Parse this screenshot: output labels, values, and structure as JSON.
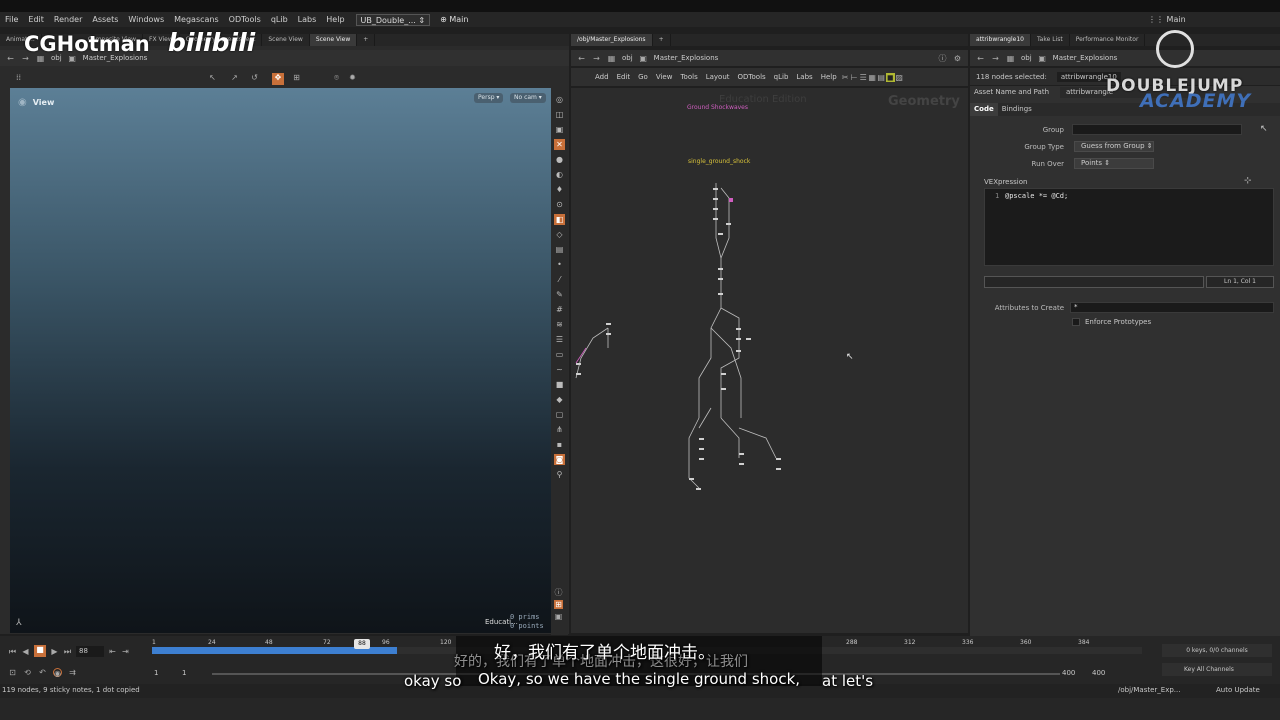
{
  "menubar": {
    "items": [
      "File",
      "Edit",
      "Render",
      "Assets",
      "Windows",
      "Megascans",
      "ODTools",
      "qLib",
      "Labs",
      "Help"
    ],
    "desktop_left": "UB_Double_...",
    "desktop_mid": "Main",
    "desktop_right": "Main"
  },
  "left_pane": {
    "tabs": [
      "Animati...",
      "Composite View",
      "FX View",
      "Geometry Spreadsheet",
      "Scene View",
      "Scene View"
    ],
    "path": [
      "obj",
      "Master_Explosions"
    ],
    "viewport_label": "View",
    "persp": "Persp",
    "nocam": "No cam",
    "prims": "0   prims",
    "points": "0   points",
    "edu": "Educati..."
  },
  "mid_pane": {
    "tabs": [
      "/obj/Master_Explosions"
    ],
    "path": [
      "obj",
      "Master_Explosions"
    ],
    "menu": [
      "Add",
      "Edit",
      "Go",
      "View",
      "Tools",
      "Layout",
      "ODTools",
      "qLib",
      "Labs",
      "Help"
    ],
    "watermark_left": "Education Edition",
    "watermark_right": "Geometry",
    "sticky_pink": "Ground Shockwaves",
    "sticky_yellow": "single_ground_shock"
  },
  "right_pane": {
    "tabs": [
      "attribwrangle10",
      "Take List",
      "Performance Monitor"
    ],
    "path": [
      "obj",
      "Master_Explosions"
    ],
    "nodes_selected": "118 nodes selected:",
    "node_name": "attribwrangle10",
    "asset_label": "Asset Name and Path",
    "asset_value": "attribwrangle",
    "subtabs": [
      "Code",
      "Bindings"
    ],
    "group_label": "Group",
    "group_type_label": "Group Type",
    "group_type_value": "Guess from Group",
    "run_over_label": "Run Over",
    "run_over_value": "Points",
    "vex_label": "VEXpression",
    "code_line_no": "1",
    "code": "@pscale *= @Cd;",
    "cursor_pos": "Ln 1, Col 1",
    "attrs_label": "Attributes to Create",
    "attrs_value": "*",
    "enforce_label": "Enforce Prototypes"
  },
  "timeline": {
    "ticks": [
      "1",
      "24",
      "48",
      "72",
      "96",
      "120",
      "288",
      "312",
      "336",
      "360",
      "384"
    ],
    "current_frame": "88",
    "frame_marker": "88",
    "start": "1",
    "start2": "1",
    "end": "400",
    "end2": "400",
    "keys": "0 keys, 0/0 channels",
    "key_all": "Key All Channels",
    "status": "119 nodes, 9 sticky notes, 1 dot copied",
    "status_path": "/obj/Master_Exp...",
    "auto_update": "Auto Update"
  },
  "subtitles": {
    "zh_top": "好，我们有了单个地面冲击。",
    "zh_faded": "好的，我们有了单个地面冲击，这很好，让我们",
    "en_left": "okay so",
    "en_main": "Okay, so we have the single ground shock,",
    "en_right": "at let's"
  },
  "watermarks": {
    "cghotman": "CGHotman",
    "bilibili": "bilibili",
    "dj1": "DOUBLEJUMP",
    "dj2": "ACADEMY"
  },
  "colors": {
    "accent_orange": "#c8703a",
    "timeline_blue": "#3d7fd1",
    "sticky_pink": "#d05ec0",
    "sticky_yellow": "#d8c23a"
  }
}
